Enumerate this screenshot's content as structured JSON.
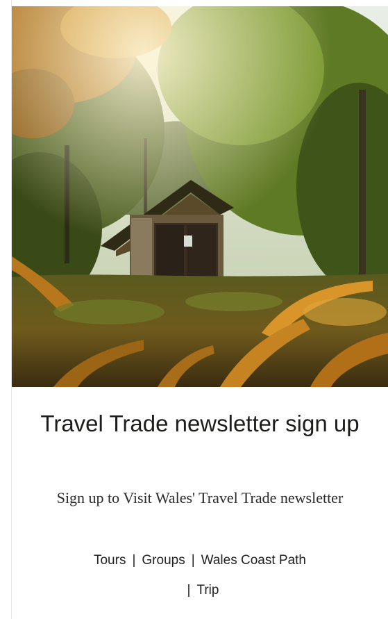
{
  "newsletter": {
    "title": "Travel Trade newsletter sign up",
    "subtitle": "Sign up to Visit Wales' Travel Trade newsletter",
    "separator": "|",
    "links": [
      {
        "label": "Tours"
      },
      {
        "label": "Groups"
      },
      {
        "label": "Wales Coast Path"
      },
      {
        "label": "Trip"
      }
    ]
  },
  "hero": {
    "subject": "wooden cabin in autumn woodland",
    "icon": "photo-image"
  },
  "colors": {
    "text": "#1d1d1b",
    "background": "#ffffff"
  }
}
